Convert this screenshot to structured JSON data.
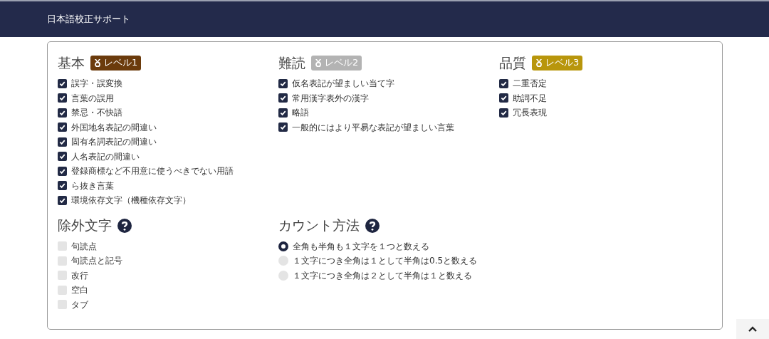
{
  "header": {
    "title": "日本語校正サポート"
  },
  "categories": [
    {
      "title": "基本",
      "badge": {
        "label": "レベル1",
        "color": "#6b3b0c"
      },
      "items": [
        {
          "label": "誤字・誤変換",
          "checked": true
        },
        {
          "label": "言葉の誤用",
          "checked": true
        },
        {
          "label": "禁忌・不快語",
          "checked": true
        },
        {
          "label": "外国地名表記の間違い",
          "checked": true
        },
        {
          "label": "固有名詞表記の間違い",
          "checked": true
        },
        {
          "label": "人名表記の間違い",
          "checked": true
        },
        {
          "label": "登録商標など不用意に使うべきでない用語",
          "checked": true
        },
        {
          "label": "ら抜き言葉",
          "checked": true
        },
        {
          "label": "環境依存文字（機種依存文字）",
          "checked": true
        }
      ]
    },
    {
      "title": "難読",
      "badge": {
        "label": "レベル2",
        "color": "#b3b3b3"
      },
      "items": [
        {
          "label": "仮名表記が望ましい当て字",
          "checked": true
        },
        {
          "label": "常用漢字表外の漢字",
          "checked": true
        },
        {
          "label": "略語",
          "checked": true
        },
        {
          "label": "一般的にはより平易な表記が望ましい言葉",
          "checked": true
        }
      ]
    },
    {
      "title": "品質",
      "badge": {
        "label": "レベル3",
        "color": "#b8960c"
      },
      "items": [
        {
          "label": "二重否定",
          "checked": true
        },
        {
          "label": "助詞不足",
          "checked": true
        },
        {
          "label": "冗長表現",
          "checked": true
        }
      ]
    }
  ],
  "exclusions": {
    "title": "除外文字",
    "items": [
      {
        "label": "句読点",
        "checked": false
      },
      {
        "label": "句読点と記号",
        "checked": false
      },
      {
        "label": "改行",
        "checked": false
      },
      {
        "label": "空白",
        "checked": false
      },
      {
        "label": "タブ",
        "checked": false
      }
    ]
  },
  "count_method": {
    "title": "カウント方法",
    "options": [
      {
        "label": "全角も半角も１文字を１つと数える",
        "selected": true
      },
      {
        "label": "１文字につき全角は１として半角は0.5と数える",
        "selected": false
      },
      {
        "label": "１文字につき全角は２として半角は１と数える",
        "selected": false
      }
    ]
  }
}
